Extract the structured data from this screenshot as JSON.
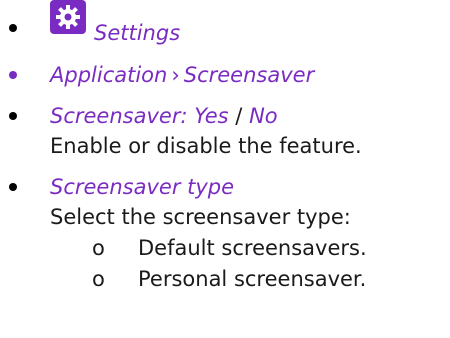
{
  "colors": {
    "accent": "#7a2cc2",
    "text": "#1a1a1a",
    "bullet_primary": "#000000",
    "bullet_secondary": "#7a2cc2"
  },
  "items": [
    {
      "icon": "gear-icon",
      "label": "Settings"
    },
    {
      "parts": [
        "Application",
        "Screensaver"
      ],
      "separator": "›"
    },
    {
      "option_name": "Screensaver:",
      "opt_yes": "Yes",
      "slash": "/",
      "opt_no": "No",
      "description": "Enable or disable the feature."
    },
    {
      "option_name": "Screensaver type",
      "description": "Select the screensaver type:",
      "sub_items": [
        {
          "marker": "o",
          "text": "Default screensavers."
        },
        {
          "marker": "o",
          "text": "Personal screensaver."
        }
      ]
    }
  ]
}
